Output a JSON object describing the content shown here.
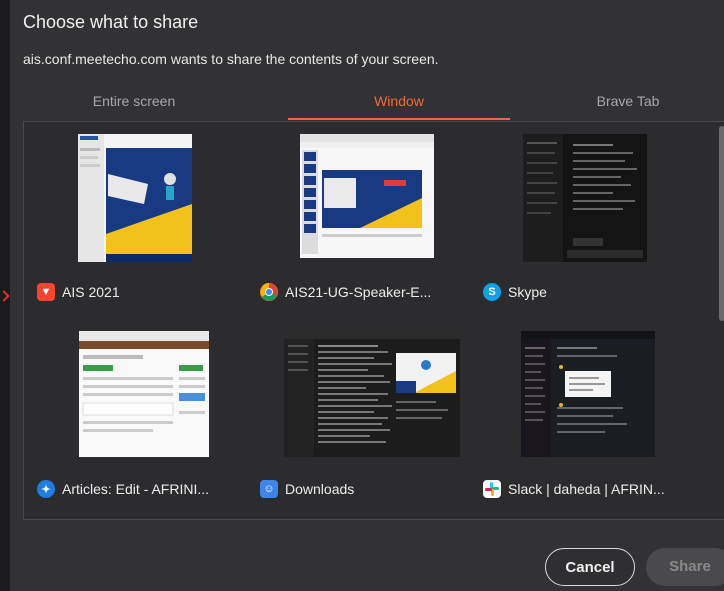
{
  "dialog": {
    "title": "Choose what to share",
    "subtitle": "ais.conf.meetecho.com wants to share the contents of your screen."
  },
  "tabs": [
    {
      "label": "Entire screen",
      "active": false
    },
    {
      "label": "Window",
      "active": true
    },
    {
      "label": "Brave Tab",
      "active": false
    }
  ],
  "windows": [
    {
      "title": "AIS 2021",
      "icon": "brave-icon"
    },
    {
      "title": "AIS21-UG-Speaker-E...",
      "icon": "chrome-icon"
    },
    {
      "title": "Skype",
      "icon": "skype-icon"
    },
    {
      "title": "Articles: Edit - AFRINI...",
      "icon": "safari-icon"
    },
    {
      "title": "Downloads",
      "icon": "finder-icon"
    },
    {
      "title": "Slack | daheda | AFRIN...",
      "icon": "slack-icon"
    }
  ],
  "buttons": {
    "cancel": "Cancel",
    "share": "Share"
  },
  "colors": {
    "accent": "#f06a3a",
    "background": "#323234"
  }
}
